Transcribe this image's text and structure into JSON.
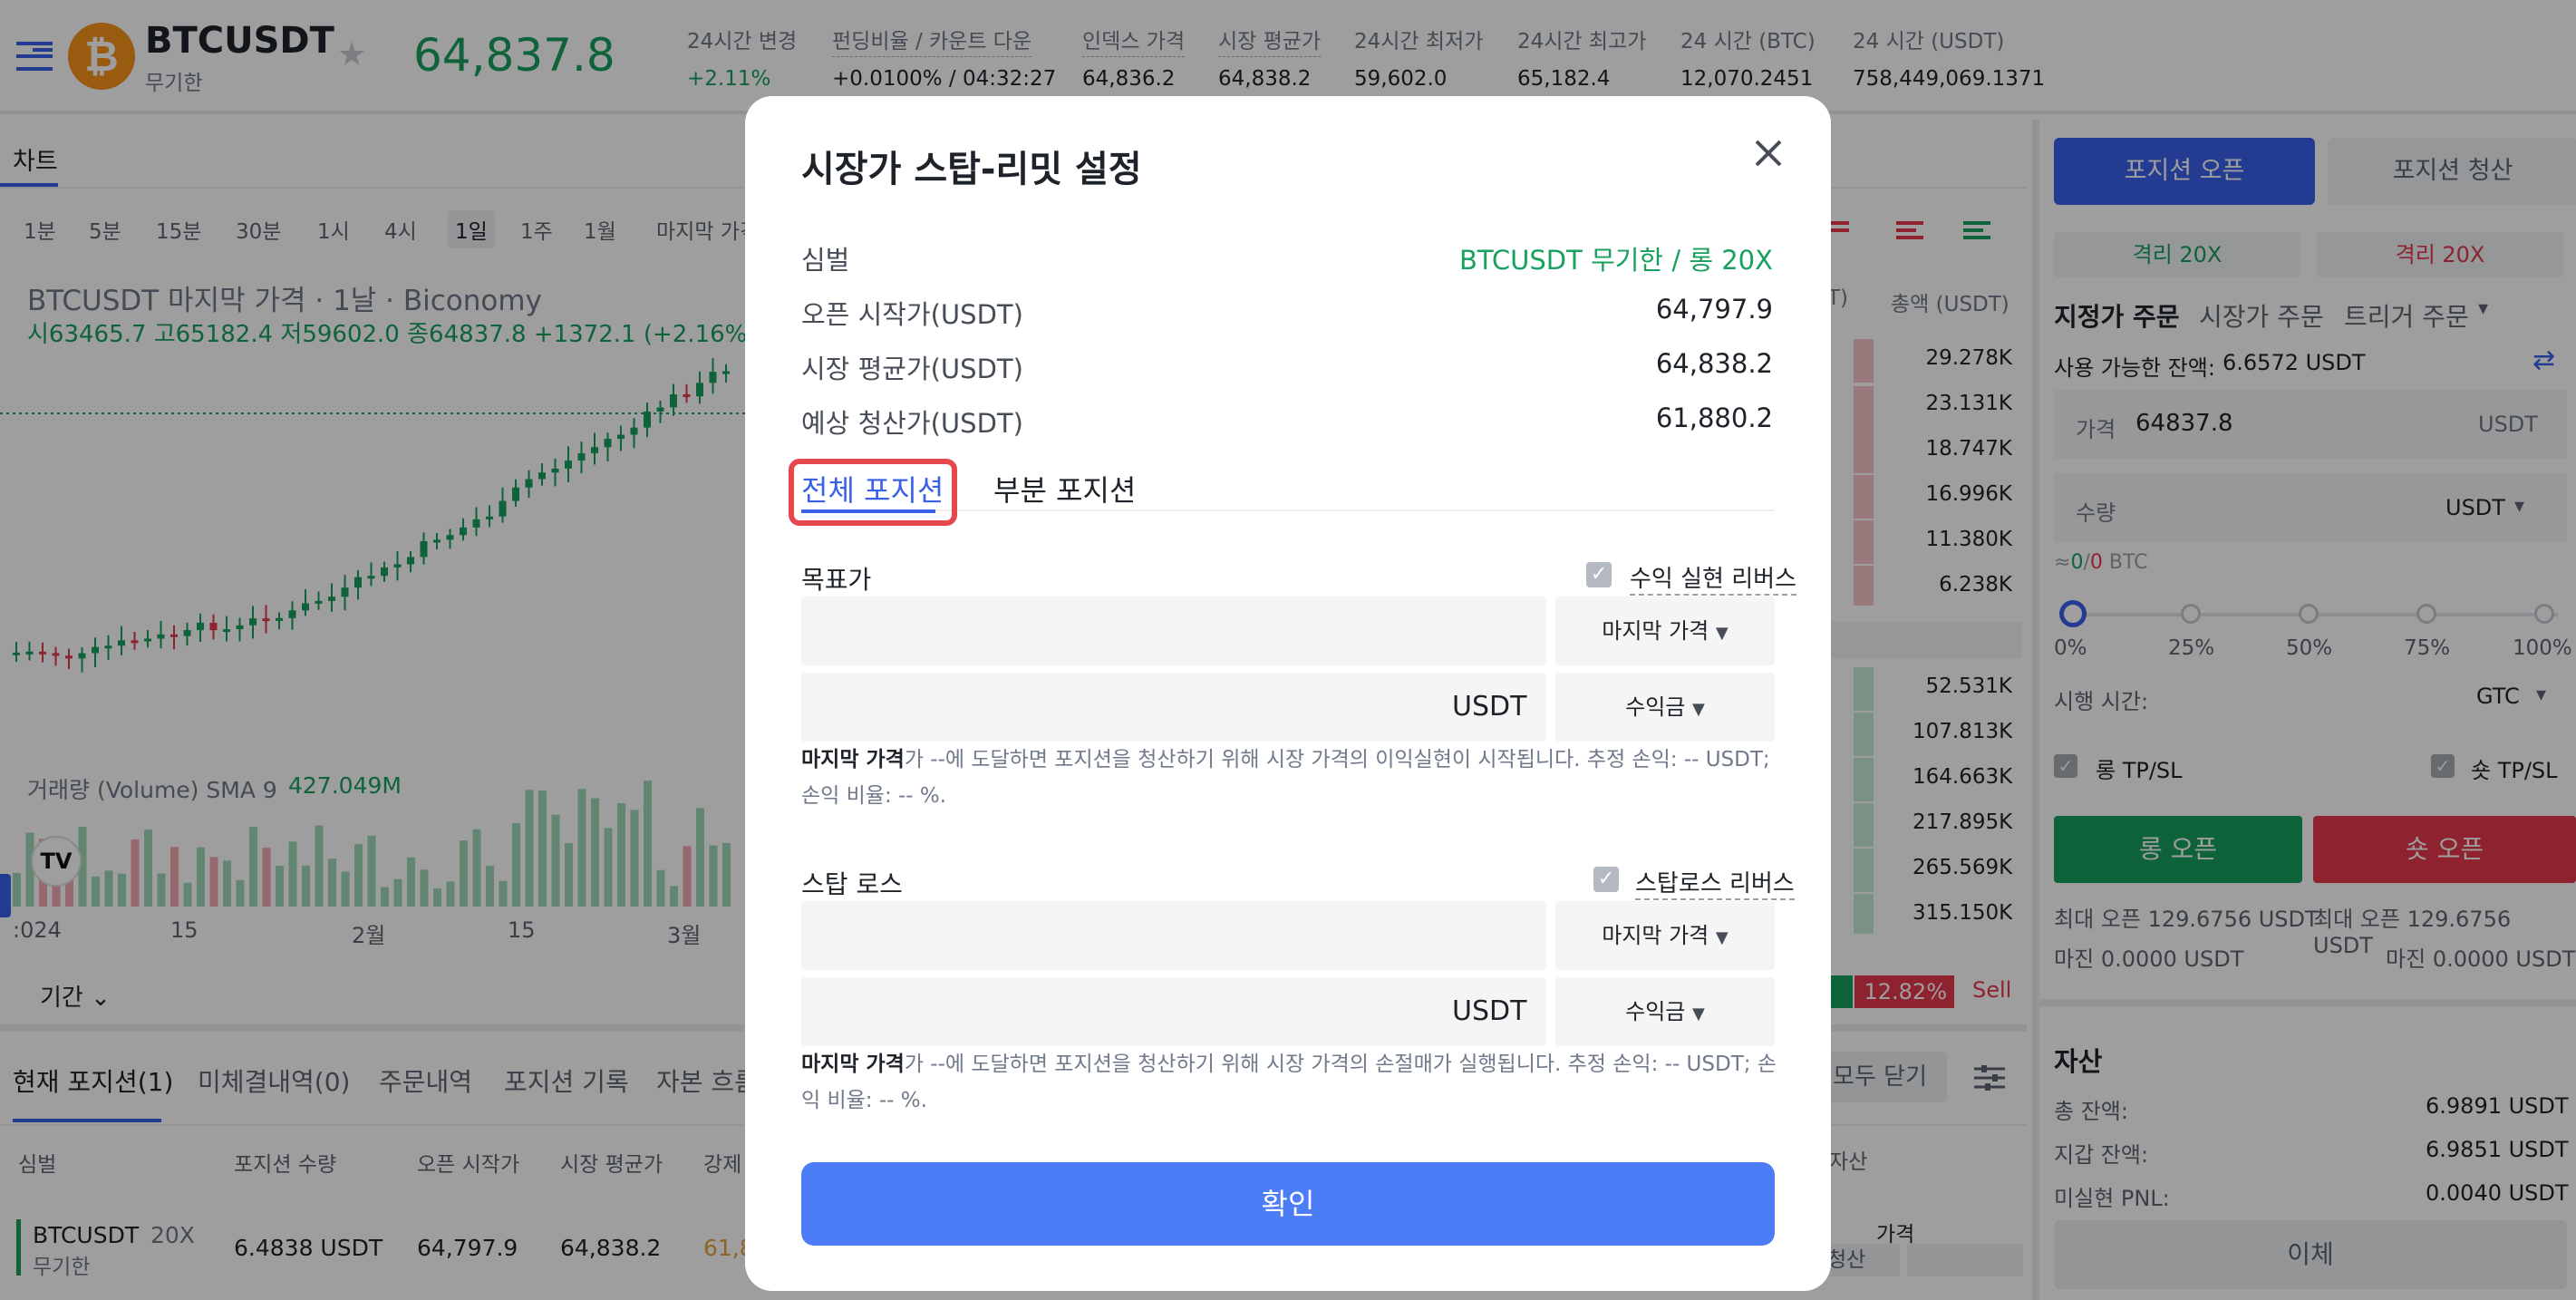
{
  "header": {
    "symbol": "BTCUSDT",
    "contract": "무기한",
    "last_price": "64,837.8",
    "stats": [
      {
        "label": "24시간 변경",
        "value": "+2.11%"
      },
      {
        "label": "펀딩비율 / 카운트 다운",
        "value": "+0.0100% / 04:32:27"
      },
      {
        "label": "인덱스 가격",
        "value": "64,836.2"
      },
      {
        "label": "시장 평균가",
        "value": "64,838.2"
      },
      {
        "label": "24시간 최저가",
        "value": "59,602.0"
      },
      {
        "label": "24시간 최고가",
        "value": "65,182.4"
      },
      {
        "label": "24 시간 (BTC)",
        "value": "12,070.2451"
      },
      {
        "label": "24 시간 (USDT)",
        "value": "758,449,069.1371"
      }
    ]
  },
  "chart_panel": {
    "tab": "차트",
    "timeframes": [
      "1분",
      "5분",
      "15분",
      "30분",
      "1시",
      "4시",
      "1일",
      "1주",
      "1월",
      "마지막 가격"
    ],
    "title": "BTCUSDT 마지막 가격 · 1날 · Biconomy",
    "ohlc": "시63465.7 고65182.4 저59602.0 종64837.8 +1372.1 (+2.16%)",
    "volume_label": "거래량 (Volume) SMA 9",
    "volume_value": "427.049M",
    "x_labels": [
      ":024",
      "15",
      "2월",
      "15",
      "3월"
    ],
    "period": "기간"
  },
  "bottom_tabs": [
    "현재 포지션(1)",
    "미체결내역(0)",
    "주문내역",
    "포지션 기록",
    "자본 흐름"
  ],
  "close_all": "모두 닫기",
  "position_headers": [
    "심벌",
    "포지션 수량",
    "오픈 시작가",
    "시장 평균가",
    "강제"
  ],
  "position_row": {
    "symbol": "BTCUSDT",
    "leverage": "20X",
    "type": "무기한",
    "qty": "6.4838 USDT",
    "open": "64,797.9",
    "avg": "64,838.2",
    "liq": "61,8"
  },
  "orderbook": {
    "headers": [
      "T)",
      "총액 (USDT)"
    ],
    "asks": [
      "29.278K",
      "23.131K",
      "18.747K",
      "16.996K",
      "11.380K",
      "6.238K"
    ],
    "bids": [
      "52.531K",
      "107.813K",
      "164.663K",
      "217.895K",
      "265.569K",
      "315.150K"
    ],
    "sell_pct": "12.82%",
    "sell_label": "Sell",
    "extra": [
      "자산",
      "가격",
      "청산"
    ]
  },
  "right_panel": {
    "open_btn": "포지션 오픈",
    "close_btn": "포지션 청산",
    "lev_long": "격리 20X",
    "lev_short": "격리 20X",
    "order_tabs": [
      "지정가 주문",
      "시장가 주문",
      "트리거 주문"
    ],
    "available_label": "사용 가능한 잔액:",
    "available_value": "6.6572 USDT",
    "price_label": "가격",
    "price_value": "64837.8",
    "price_unit": "USDT",
    "qty_label": "수량",
    "qty_unit": "USDT",
    "approx_prefix": "≈",
    "approx_a": "0",
    "approx_sep": "/",
    "approx_b": "0",
    "approx_unit": "BTC",
    "slider_marks": [
      "0%",
      "25%",
      "50%",
      "75%",
      "100%"
    ],
    "tif_label": "시행 시간:",
    "tif_value": "GTC",
    "long_tpsl": "롱 TP/SL",
    "short_tpsl": "숏 TP/SL",
    "long_btn": "롱 오픈",
    "short_btn": "숏 오픈",
    "max_open_label": "최대 오픈",
    "max_open_long": "129.6756 USDT",
    "max_open_short": "129.6756 USDT",
    "margin_label": "마진",
    "margin_long": "0.0000 USDT",
    "margin_short": "0.0000 USDT",
    "assets_title": "자산",
    "total_label": "총 잔액:",
    "total_value": "6.9891 USDT",
    "wallet_label": "지갑 잔액:",
    "wallet_value": "6.9851 USDT",
    "pnl_label": "미실현 PNL:",
    "pnl_value": "0.0040 USDT",
    "transfer_btn": "이체"
  },
  "modal": {
    "title": "시장가 스탑-리밋 설정",
    "rows": [
      {
        "label": "심벌",
        "value": "BTCUSDT 무기한 / 롱 20X"
      },
      {
        "label": "오픈 시작가(USDT)",
        "value": "64,797.9"
      },
      {
        "label": "시장 평균가(USDT)",
        "value": "64,838.2"
      },
      {
        "label": "예상 청산가(USDT)",
        "value": "61,880.2"
      }
    ],
    "tab_all": "전체 포지션",
    "tab_partial": "부분 포지션",
    "tp": {
      "label": "목표가",
      "checkbox": "수익 실현 리버스",
      "trigger_select": "마지막 가격",
      "unit": "USDT",
      "amount_select": "수익금",
      "note_bold": "마지막 가격",
      "note_text": "가 --에 도달하면 포지션을 청산하기 위해 시장 가격의 이익실현이 시작됩니다. 추정 손익: -- USDT; 손익 비율: -- %."
    },
    "sl": {
      "label": "스탑 로스",
      "checkbox": "스탑로스 리버스",
      "trigger_select": "마지막 가격",
      "unit": "USDT",
      "amount_select": "수익금",
      "note_bold": "마지막 가격",
      "note_text": "가 --에 도달하면 포지션을 청산하기 위해 시장 가격의 손절매가 실행됩니다. 추정 손익: -- USDT; 손익 비율: -- %."
    },
    "confirm": "확인"
  },
  "colors": {
    "green": "#18a05e",
    "red": "#e5384c",
    "blue": "#3960e8",
    "confirm": "#4c7cf6",
    "highlight": "#e5484d"
  }
}
